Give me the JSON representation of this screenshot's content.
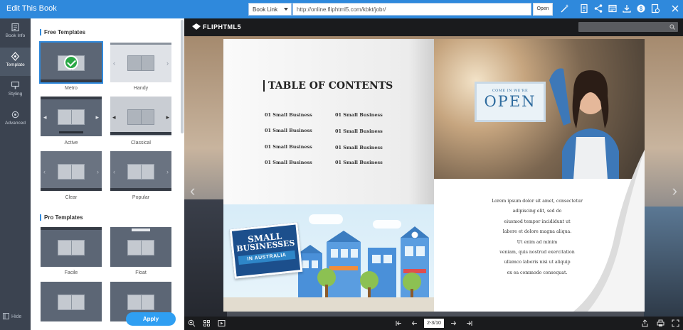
{
  "app": {
    "title": "Edit This Book",
    "link_type": "Book Link",
    "url": "http://online.fliphtml5.com/kbkt/jobr/",
    "open_label": "Open"
  },
  "toolbar_icons": [
    "magic-wand-icon",
    "document-icon",
    "share-icon",
    "image-icon",
    "download-icon",
    "dollar-icon",
    "bookmark-icon",
    "close-icon"
  ],
  "sidebar": {
    "items": [
      {
        "label": "Book Info",
        "icon": "book-info-icon"
      },
      {
        "label": "Template",
        "icon": "template-icon"
      },
      {
        "label": "Styling",
        "icon": "styling-icon"
      },
      {
        "label": "Advanced",
        "icon": "advanced-icon"
      }
    ],
    "active": "Template",
    "hide_label": "Hide"
  },
  "panel": {
    "free_heading": "Free Templates",
    "pro_heading": "Pro Templates",
    "free_templates": [
      {
        "name": "Metro",
        "selected": true
      },
      {
        "name": "Handy",
        "selected": false
      },
      {
        "name": "Active",
        "selected": false
      },
      {
        "name": "Classical",
        "selected": false
      },
      {
        "name": "Clear",
        "selected": false
      },
      {
        "name": "Popular",
        "selected": false
      }
    ],
    "pro_templates": [
      {
        "name": "Facile"
      },
      {
        "name": "Float"
      }
    ],
    "apply_label": "Apply"
  },
  "viewer": {
    "logo_text": "FLIPHTML5",
    "page_indicator": "2-3/10",
    "left_page": {
      "toc_title": "TABLE OF CONTENTS",
      "toc_items": [
        "01 Small Business",
        "01 Small Business",
        "01 Small Business",
        "01 Small Business",
        "01 Small Business",
        "01 Small Business",
        "01 Small Business",
        "01 Small Business"
      ],
      "sign_line1": "SMALL",
      "sign_line2": "BUSINESSES",
      "sign_banner": "IN AUSTRALIA"
    },
    "right_page": {
      "sign_small": "COME IN WE'RE",
      "sign_big": "OPEN",
      "lorem_lines": [
        "Lorem ipsum dolor sit amet, consectetur",
        "adipiscing elit, sed do",
        "eiusmod tempor incididunt ut",
        "labore et dolore magna aliqua.",
        "Ut enim ad minim",
        "veniam, quis nostrud exercitation",
        "ullamco laboris nisi ut aliquip",
        "ex ea commodo consequat."
      ]
    }
  },
  "colors": {
    "accent": "#2f89dc",
    "sidebar": "#3b4350",
    "apply": "#2f9ff2",
    "check": "#29a745",
    "sign_blue": "#1c4f8c"
  }
}
